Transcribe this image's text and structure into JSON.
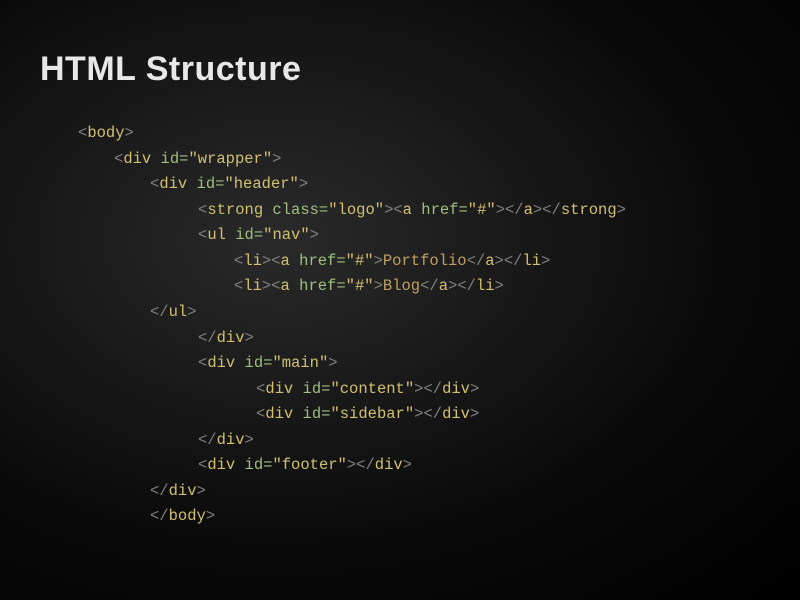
{
  "title": "HTML Structure",
  "code": {
    "l1": "<body>",
    "l2_open": "<div",
    "l2_attr": " id=",
    "l2_val": "\"wrapper\"",
    "l2_close": ">",
    "l3_open": "<div",
    "l3_attr": " id=",
    "l3_val": "\"header\"",
    "l3_close": ">",
    "l4_strong_open": "<strong",
    "l4_strong_attr": " class=",
    "l4_strong_val": "\"logo\"",
    "l4_strong_close": ">",
    "l4_a_open": "<a",
    "l4_a_attr": " href=",
    "l4_a_val": "\"#\"",
    "l4_a_close": ">",
    "l4_a_end": "</a>",
    "l4_strong_end": "</strong>",
    "l5_ul_open": "<ul",
    "l5_ul_attr": " id=",
    "l5_ul_val": "\"nav\"",
    "l5_ul_close": ">",
    "l6_li_open": "<li>",
    "l6_a_open": "<a",
    "l6_a_attr": " href=",
    "l6_a_val": "\"#\"",
    "l6_a_close": ">",
    "l6_text": "Portfolio",
    "l6_a_end": "</a>",
    "l6_li_end": "</li>",
    "l7_li_open": "<li>",
    "l7_a_open": "<a",
    "l7_a_attr": " href=",
    "l7_a_val": "\"#\"",
    "l7_a_close": ">",
    "l7_text": "Blog",
    "l7_a_end": "</a>",
    "l7_li_end": "</li>",
    "l8_ul_end": "</ul>",
    "l9_div_end": "</div>",
    "l10_div_open": "<div",
    "l10_attr": " id=",
    "l10_val": "\"main\"",
    "l10_close": ">",
    "l11_div_open": "<div",
    "l11_attr": " id=",
    "l11_val": "\"content\"",
    "l11_close": ">",
    "l11_end": "</div>",
    "l12_div_open": "<div",
    "l12_attr": " id=",
    "l12_val": "\"sidebar\"",
    "l12_close": ">",
    "l12_end": "</div>",
    "l13_div_end": "</div>",
    "l14_div_open": "<div",
    "l14_attr": " id=",
    "l14_val": "\"footer\"",
    "l14_close": ">",
    "l14_end": "</div>",
    "l15_div_end": "</div>",
    "l16_body_end": "</body>"
  }
}
